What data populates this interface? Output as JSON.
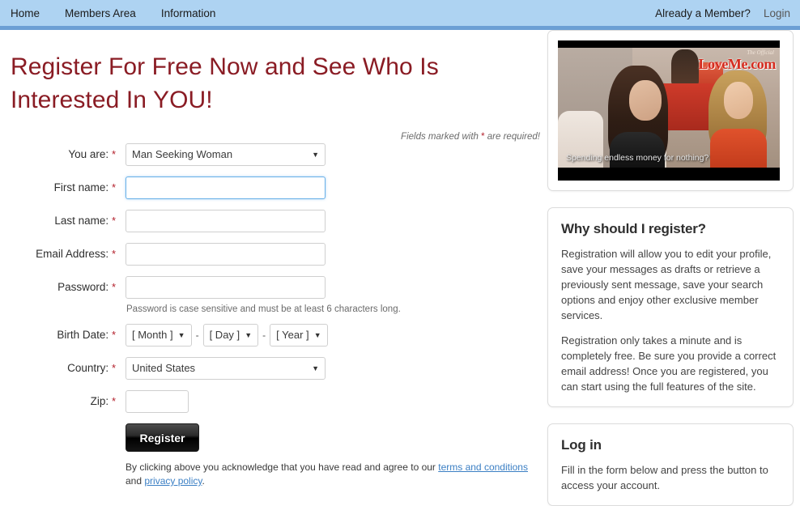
{
  "nav": {
    "left_items": [
      {
        "label": "Home",
        "name": "nav-item-home"
      },
      {
        "label": "Members Area",
        "name": "nav-item-members-area"
      },
      {
        "label": "Information",
        "name": "nav-item-information"
      }
    ],
    "member_prompt": "Already a Member?",
    "login_label": "Login",
    "bar_color": "#aed3f2",
    "underline_color": "#6c9fd4"
  },
  "main": {
    "title": "Register For Free Now and See Who Is Interested In YOU!",
    "title_color": "#8a1c24",
    "required_note_prefix": "Fields marked with ",
    "required_note_star": "*",
    "required_note_suffix": " are required!"
  },
  "form": {
    "you_are": {
      "label": "You are:",
      "value": "Man Seeking Woman"
    },
    "first_name": {
      "label": "First name:",
      "value": "",
      "focused": true
    },
    "last_name": {
      "label": "Last name:",
      "value": ""
    },
    "email": {
      "label": "Email Address:",
      "value": ""
    },
    "password": {
      "label": "Password:",
      "value": "",
      "help": "Password is case sensitive and must be at least 6 characters long."
    },
    "birth_date": {
      "label": "Birth Date:",
      "month": "[ Month ]",
      "day": "[ Day ]",
      "year": "[ Year ]",
      "separator": "-"
    },
    "country": {
      "label": "Country:",
      "value": "United States"
    },
    "zip": {
      "label": "Zip:",
      "value": ""
    },
    "required_star": "*",
    "submit_label": "Register",
    "terms_text_before": "By clicking above you acknowledge that you have read and agree to our ",
    "terms_link": "terms and conditions",
    "terms_text_middle": " and ",
    "privacy_link": "privacy policy",
    "terms_text_after": "."
  },
  "sidebar": {
    "video": {
      "caption": "Spending endless money for nothing?",
      "logo_small": "The Official",
      "logo_main": "LoveMe.com"
    },
    "why_register": {
      "title": "Why should I register?",
      "paragraph_1": "Registration will allow you to edit your profile, save your messages as drafts or retrieve a previously sent message, save your search options and enjoy other exclusive member services.",
      "paragraph_2": "Registration only takes a minute and is completely free. Be sure you provide a correct email address! Once you are registered, you can start using the full features of the site."
    },
    "log_in": {
      "title": "Log in",
      "paragraph_1": "Fill in the form below and press the button to access your account."
    }
  }
}
